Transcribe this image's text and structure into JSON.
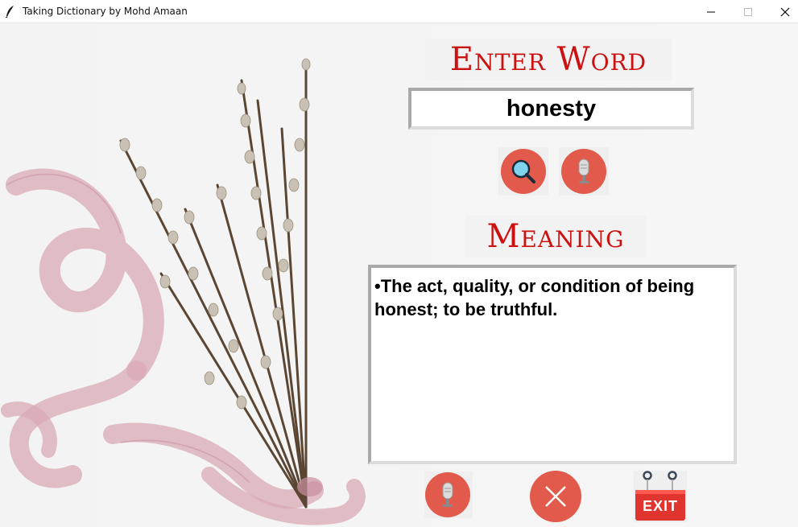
{
  "window": {
    "title": "Taking Dictionary by Mohd Amaan",
    "minimize_symbol": "—",
    "maximize_symbol": "☐",
    "close_symbol": "✕"
  },
  "search": {
    "heading": "Enter Word",
    "input_value": "honesty"
  },
  "meaning": {
    "heading": "Meaning",
    "text": "•The act, quality, or condition of being honest; to be truthful."
  },
  "buttons": {
    "search_icon": "magnifier-icon",
    "voice_input_icon": "microphone-icon",
    "speak_meaning_icon": "microphone-icon",
    "clear_icon": "close-icon",
    "exit_label": "EXIT"
  },
  "colors": {
    "heading": "#cc1111",
    "button_red": "#e25a4b",
    "exit_red": "#e0342e"
  }
}
